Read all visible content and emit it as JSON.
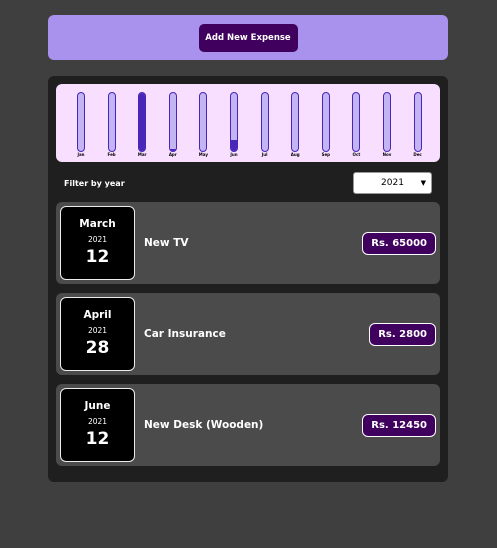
{
  "new_expense": {
    "add_label": "Add New Expense"
  },
  "chart_data": {
    "type": "bar",
    "categories": [
      "Jan",
      "Feb",
      "Mar",
      "Apr",
      "May",
      "Jun",
      "Jul",
      "Aug",
      "Sep",
      "Oct",
      "Nov",
      "Dec"
    ],
    "values": [
      0,
      0,
      65000,
      2800,
      0,
      12450,
      0,
      0,
      0,
      0,
      0,
      0
    ],
    "title": "",
    "xlabel": "",
    "ylabel": "",
    "ylim": [
      0,
      65000
    ]
  },
  "filter": {
    "label": "Filter by year",
    "selected": "2021"
  },
  "expenses": [
    {
      "month": "March",
      "year": "2021",
      "day": "12",
      "title": "New TV",
      "amount": "Rs. 65000"
    },
    {
      "month": "April",
      "year": "2021",
      "day": "28",
      "title": "Car Insurance",
      "amount": "Rs. 2800"
    },
    {
      "month": "June",
      "year": "2021",
      "day": "12",
      "title": "New Desk (Wooden)",
      "amount": "Rs. 12450"
    }
  ],
  "colors": {
    "accent": "#40005d",
    "bar_fill": "#4826b9",
    "bar_empty": "#c3b4f3",
    "chart_bg": "#f8dfff",
    "header_bg": "#a892ee"
  }
}
